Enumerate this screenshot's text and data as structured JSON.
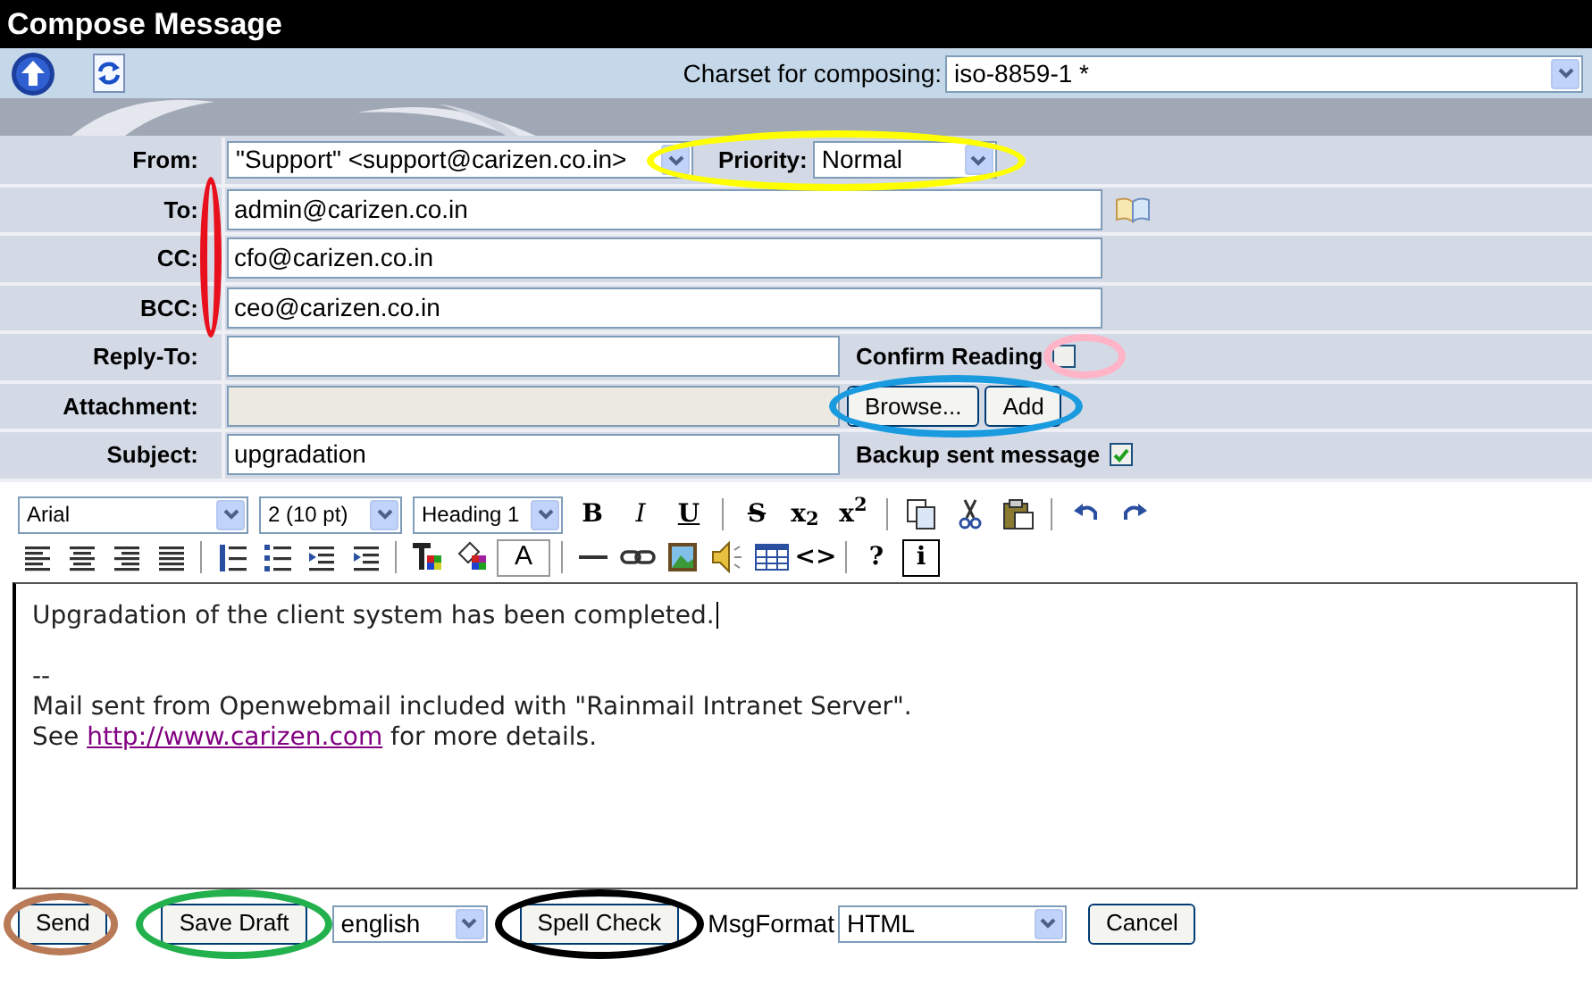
{
  "window": {
    "title": "Compose Message"
  },
  "toolbar": {
    "charset_label": "Charset for composing:",
    "charset": "iso-8859-1 *"
  },
  "from": {
    "label": "From:",
    "value": "\"Support\" <support@carizen.co.in>",
    "priority_label": "Priority:",
    "priority": "Normal",
    "highlight": {
      "color": "#ffff00"
    }
  },
  "recipients": {
    "highlight": {
      "color": "#e8101c"
    },
    "rows": [
      {
        "label": "To:",
        "value": "admin@carizen.co.in",
        "address_book": true
      },
      {
        "label": "CC:",
        "value": "cfo@carizen.co.in",
        "address_book": false
      },
      {
        "label": "BCC:",
        "value": "ceo@carizen.co.in",
        "address_book": false
      }
    ]
  },
  "reply_to": {
    "label": "Reply-To:",
    "confirm_label": "Confirm Reading",
    "confirm_checked": false,
    "highlight": {
      "color": "#ffb4c8"
    }
  },
  "attachment": {
    "label": "Attachment:",
    "buttons": [
      "Browse...",
      "Add"
    ],
    "highlight": {
      "color": "#1a9be0"
    }
  },
  "subject": {
    "label": "Subject:",
    "value": "upgradation",
    "backup_label": "Backup sent message",
    "backup_checked": true
  },
  "editor": {
    "font": "Arial",
    "size": "2 (10 pt)",
    "block": "Heading 1",
    "style_buttons": [
      "B",
      "I",
      "U"
    ],
    "script_buttons": [
      "S",
      "x$_{2}$",
      "x$^{2}$"
    ],
    "font_color_button": "A",
    "source_button": "<>",
    "help_button": "?",
    "info_button": "i",
    "paragraphs": [
      [
        {
          "text": "Upgradation of the client system has been completed.",
          "caret": true
        }
      ],
      [
        {
          "text": "--",
          "caret": false
        },
        {
          "text": "Mail sent from Openwebmail included with \"Rainmail Intranet Server\".",
          "caret": false
        },
        {
          "before": "See ",
          "link": "http://www.carizen.com",
          "after": " for more details.",
          "caret": false
        }
      ]
    ]
  },
  "footer": {
    "send": {
      "label": "Send",
      "highlight": {
        "color": "#b97a57"
      }
    },
    "save_draft": {
      "label": "Save Draft",
      "highlight": {
        "color": "#22b14c"
      }
    },
    "language": "english",
    "spell_check": {
      "label": "Spell Check",
      "highlight": {
        "color": "#000000"
      }
    },
    "format_label": "MsgFormat",
    "format": "HTML",
    "cancel": "Cancel"
  }
}
